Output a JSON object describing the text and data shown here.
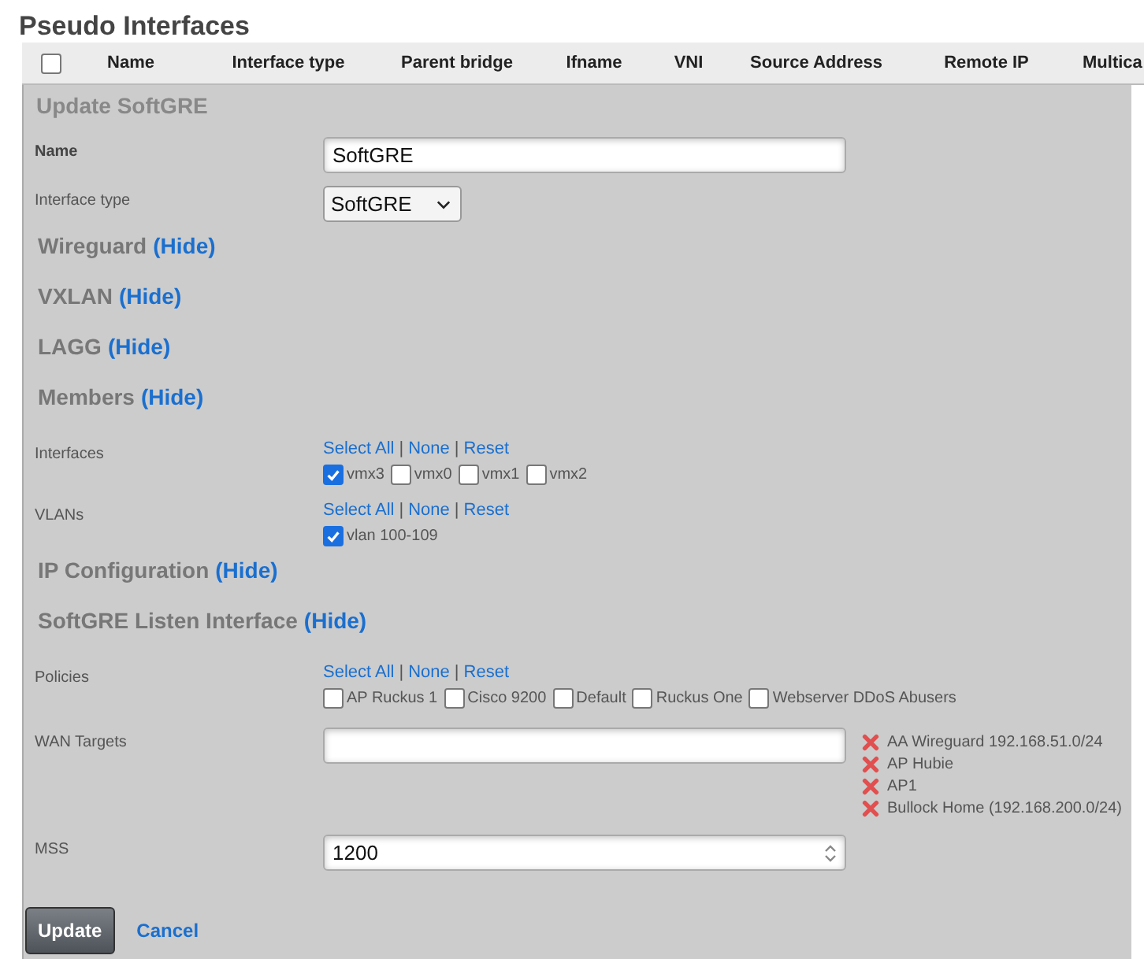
{
  "page_title": "Pseudo Interfaces",
  "table": {
    "select_all": {
      "checked": false
    },
    "columns": [
      "Name",
      "Interface type",
      "Parent bridge",
      "Ifname",
      "VNI",
      "Source Address",
      "Remote IP",
      "Multica"
    ]
  },
  "form": {
    "title": "Update SoftGRE",
    "items": [
      {
        "kind": "text",
        "label": "Name",
        "value": "SoftGRE",
        "bold": true
      },
      {
        "kind": "select",
        "label": "Interface type",
        "value": "SoftGRE"
      },
      {
        "kind": "heading",
        "title": "Wireguard",
        "toggle": "(Hide)"
      },
      {
        "kind": "heading",
        "title": "VXLAN",
        "toggle": "(Hide)"
      },
      {
        "kind": "heading",
        "title": "LAGG",
        "toggle": "(Hide)"
      },
      {
        "kind": "heading",
        "title": "Members",
        "toggle": "(Hide)"
      },
      {
        "kind": "checklist",
        "label": "Interfaces",
        "separator": "|",
        "links": [
          "Select All",
          "None",
          "Reset"
        ],
        "options": [
          {
            "label": "vmx3",
            "checked": true
          },
          {
            "label": "vmx0",
            "checked": false
          },
          {
            "label": "vmx1",
            "checked": false
          },
          {
            "label": "vmx2",
            "checked": false
          }
        ]
      },
      {
        "kind": "checklist",
        "label": "VLANs",
        "separator": "|",
        "links": [
          "Select All",
          "None",
          "Reset"
        ],
        "options": [
          {
            "label": "vlan 100-109",
            "checked": true
          }
        ]
      },
      {
        "kind": "heading",
        "title": "IP Configuration",
        "toggle": "(Hide)"
      },
      {
        "kind": "heading",
        "title": "SoftGRE Listen Interface",
        "toggle": "(Hide)"
      },
      {
        "kind": "checklist",
        "label": "Policies",
        "separator": "|",
        "links": [
          "Select All",
          "None",
          "Reset"
        ],
        "options": [
          {
            "label": "AP Ruckus 1",
            "checked": false
          },
          {
            "label": "Cisco 9200",
            "checked": false
          },
          {
            "label": "Default",
            "checked": false
          },
          {
            "label": "Ruckus One",
            "checked": false
          },
          {
            "label": "Webserver DDoS Abusers",
            "checked": false
          }
        ]
      },
      {
        "kind": "targets",
        "label": "WAN Targets",
        "targets": [
          "AA Wireguard 192.168.51.0/24",
          "AP Hubie",
          "AP1",
          "Bullock Home (192.168.200.0/24)"
        ]
      },
      {
        "kind": "number",
        "label": "MSS",
        "value": "1200"
      }
    ]
  },
  "buttons": {
    "submit": "Update",
    "cancel": "Cancel"
  }
}
